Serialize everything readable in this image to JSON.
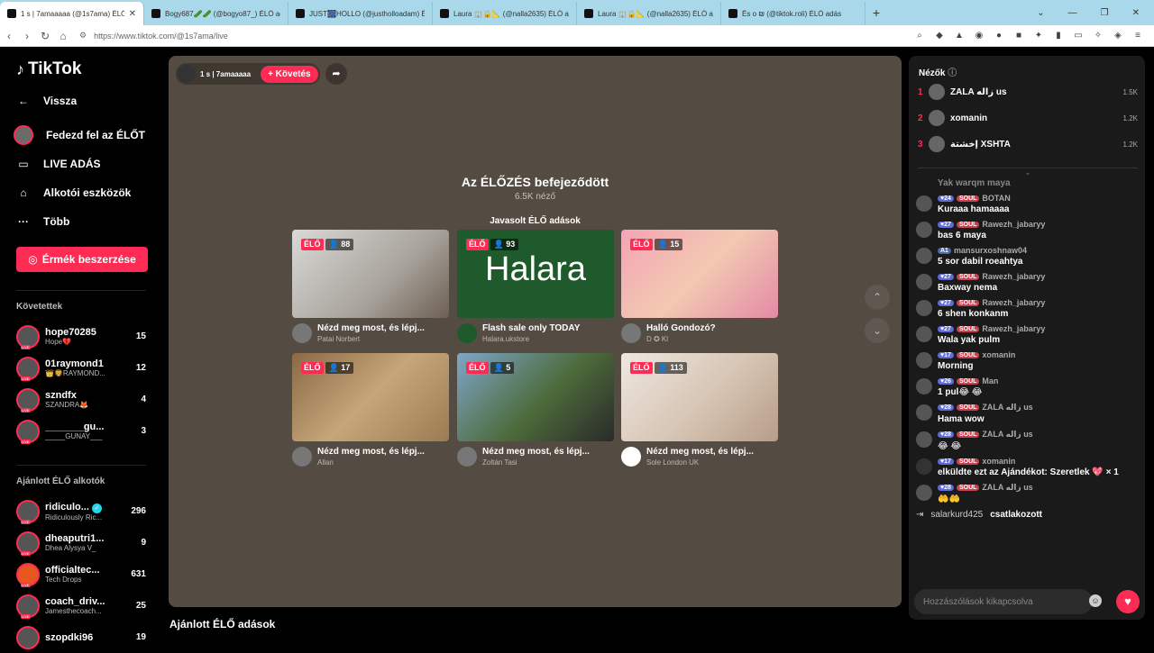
{
  "browser": {
    "tabs": [
      {
        "title": "1 s | 7amaaaaa (@1s7ama) ÉLŐ a"
      },
      {
        "title": "Bogy687🥒🥒 (@bogyo87_) ÉLŐ ad"
      },
      {
        "title": "JUST🎆HOLLO (@justholloadam) ÉL"
      },
      {
        "title": "Laura 🏢🔒📐 (@nalla2635) ÉLŐ adás"
      },
      {
        "title": "Laura 🏢🔒📐 (@nalla2635) ÉLŐ adás"
      },
      {
        "title": "Ёѕ о ₪ (@tiktok.roli) ÉLŐ adás"
      }
    ],
    "url": "https://www.tiktok.com/@1s7ama/live"
  },
  "sidebar": {
    "logo": "TikTok",
    "back": "Vissza",
    "nav": [
      {
        "label": "Fedezd fel az ÉLŐT"
      },
      {
        "label": "LIVE ADÁS"
      },
      {
        "label": "Alkotói eszközök"
      },
      {
        "label": "Több"
      }
    ],
    "coins_button": "Érmék beszerzése",
    "following_title": "Követettek",
    "following": [
      {
        "name": "hope70285",
        "sub": "Hope💔",
        "count": "15"
      },
      {
        "name": "01raymond1",
        "sub": "👑🦁RAYMOND...",
        "count": "12"
      },
      {
        "name": "szndfx",
        "sub": "SZANDRA🦊",
        "count": "4"
      },
      {
        "name": "_______gu...",
        "sub": "_____GUNAY___",
        "count": "3"
      }
    ],
    "recommended_title": "Ajánlott ÉLŐ alkotók",
    "recommended": [
      {
        "name": "ridiculo...",
        "sub": "Ridiculously Ric...",
        "count": "296"
      },
      {
        "name": "dheaputri1...",
        "sub": "Dhea Alysya V_",
        "count": "9"
      },
      {
        "name": "officialtec...",
        "sub": "Tech Drops",
        "count": "631"
      },
      {
        "name": "coach_driv...",
        "sub": "Jamesthecoach...",
        "count": "25"
      },
      {
        "name": "szopdki96",
        "sub": "",
        "count": "19"
      }
    ]
  },
  "stage": {
    "host_name": "1 s | 7amaaaaa",
    "follow_label": "+ Követés",
    "ended_title": "Az ÉLŐZÉS befejeződött",
    "viewers": "6.5K néző",
    "suggested_title": "Javasolt ÉLŐ adások",
    "live_label": "ÉLŐ",
    "cards": [
      {
        "viewers": "88",
        "title": "Nézd meg most, és lépj...",
        "creator": "Patai Norbert"
      },
      {
        "viewers": "93",
        "title": "Flash sale only TODAY",
        "creator": "Halara.ukstore",
        "brand": "Halara"
      },
      {
        "viewers": "15",
        "title": "Halló Gondozó?",
        "creator": "D ✪ Kl"
      },
      {
        "viewers": "17",
        "title": "Nézd meg most, és lépj...",
        "creator": "Allan"
      },
      {
        "viewers": "5",
        "title": "Nézd meg most, és lépj...",
        "creator": "Zoltán Tasi"
      },
      {
        "viewers": "113",
        "title": "Nézd meg most, és lépj...",
        "creator": "Sole London UK"
      }
    ],
    "below_title": "Ajánlott ÉLŐ adások"
  },
  "panel": {
    "title": "Nézők",
    "viewers": [
      {
        "rank": "1",
        "name": "ZALA زاله us",
        "count": "1.5K"
      },
      {
        "rank": "2",
        "name": "xomanin",
        "count": "1.2K"
      },
      {
        "rank": "3",
        "name": "إخشتة XSHTA",
        "count": "1.2K"
      }
    ],
    "chat_top": "Yak warqm maya",
    "chat": [
      {
        "lvl": "24",
        "soul": true,
        "user": "BOTAN",
        "text": "Kuraaa hamaaaa"
      },
      {
        "lvl": "27",
        "soul": true,
        "user": "Rawezh_jabaryy",
        "text": "bas 6 maya"
      },
      {
        "lvl": "A1",
        "soul": false,
        "user": "mansurxoshnaw04",
        "text": "5 sor dabil roeahtya"
      },
      {
        "lvl": "27",
        "soul": true,
        "user": "Rawezh_jabaryy",
        "text": "Baxway nema"
      },
      {
        "lvl": "27",
        "soul": true,
        "user": "Rawezh_jabaryy",
        "text": "6 shen konkanm"
      },
      {
        "lvl": "27",
        "soul": true,
        "user": "Rawezh_jabaryy",
        "text": "Wala yak pulm"
      },
      {
        "lvl": "17",
        "soul": true,
        "user": "xomanin",
        "text": "Morning"
      },
      {
        "lvl": "26",
        "soul": true,
        "user": "Man",
        "text": "1 pul😂 😂"
      },
      {
        "lvl": "28",
        "soul": true,
        "user": "ZALA زاله us",
        "text": "Hama wow"
      },
      {
        "lvl": "28",
        "soul": true,
        "user": "ZALA زاله us",
        "text": "😂 😂"
      },
      {
        "lvl": "17",
        "soul": true,
        "user": "xomanin",
        "text": "elküldte ezt az Ajándékot: Szeretlek 💖 × 1"
      },
      {
        "lvl": "28",
        "soul": true,
        "user": "ZALA زاله us",
        "text": "🤲🤲"
      }
    ],
    "join_user": "salarkurd425",
    "join_text": "csatlakozott",
    "input_placeholder": "Hozzászólások kikapcsolva",
    "soul_label": "SOUL"
  }
}
